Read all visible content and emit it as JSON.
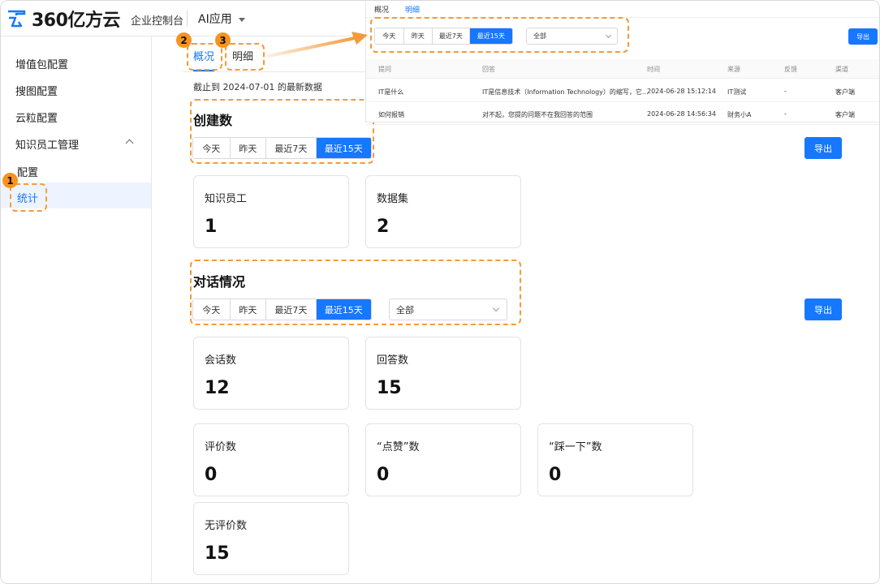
{
  "header": {
    "brand": "360亿方云",
    "console": "企业控制台",
    "app": "AI应用"
  },
  "sidebar": {
    "items": [
      {
        "label": "增值包配置"
      },
      {
        "label": "搜图配置"
      },
      {
        "label": "云粒配置"
      },
      {
        "label": "知识员工管理"
      },
      {
        "label": "配置"
      },
      {
        "label": "统计"
      }
    ]
  },
  "tabs": [
    {
      "label": "概况",
      "active": true
    },
    {
      "label": "明细",
      "active": false
    }
  ],
  "as_of": "截止到 2024-07-01 的最新数据",
  "badges": [
    "1",
    "2",
    "3"
  ],
  "create_section": {
    "title": "创建数",
    "ranges": [
      "今天",
      "昨天",
      "最近7天",
      "最近15天"
    ],
    "export": "导出",
    "cards": [
      {
        "label": "知识员工",
        "value": "1"
      },
      {
        "label": "数据集",
        "value": "2"
      }
    ]
  },
  "dialog_section": {
    "title": "对话情况",
    "ranges": [
      "今天",
      "昨天",
      "最近7天",
      "最近15天"
    ],
    "filter": "全部",
    "export": "导出",
    "cards": [
      {
        "label": "会话数",
        "value": "12"
      },
      {
        "label": "回答数",
        "value": "15"
      },
      {
        "label": "评价数",
        "value": "0"
      },
      {
        "label": "“点赞”数",
        "value": "0"
      },
      {
        "label": "“踩一下”数",
        "value": "0"
      },
      {
        "label": "无评价数",
        "value": "15"
      }
    ]
  },
  "detail_panel": {
    "tabs": [
      "概况",
      "明细"
    ],
    "ranges": [
      "今天",
      "昨天",
      "最近7天",
      "最近15天"
    ],
    "filter": "全部",
    "export": "导出",
    "columns": [
      "提问",
      "回答",
      "时间",
      "来源",
      "反馈",
      "渠道"
    ],
    "rows": [
      [
        "IT是什么",
        "IT是信息技术（Information Technology）的缩写，它...",
        "2024-06-28 15:12:14",
        "IT测试",
        "-",
        "客户端"
      ],
      [
        "如何报销",
        "对不起，您提的问题不在我回答的范围",
        "2024-06-28 14:56:34",
        "财务小A",
        "-",
        "客户端"
      ]
    ]
  },
  "colors": {
    "primary": "#1677ff",
    "highlight": "#f59a3a",
    "badge": "#f7931e"
  }
}
